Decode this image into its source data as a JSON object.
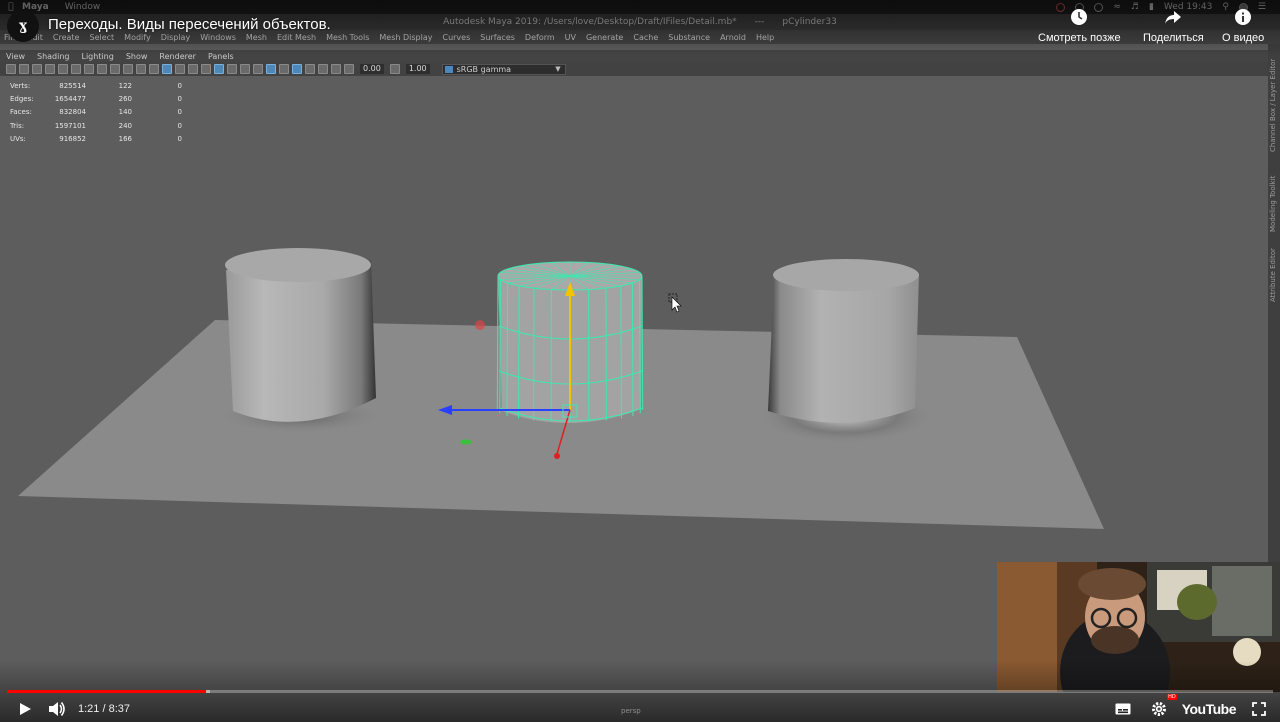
{
  "mac_menubar": {
    "app_name": "Maya",
    "items": [
      "Window"
    ],
    "clock": "Wed 19:43"
  },
  "maya": {
    "window_title": "Autodesk Maya 2019: /Users/love/Desktop/Draft/IFiles/Detail.mb*",
    "sep": "---",
    "selection": "pCylinder33",
    "menus": [
      "File",
      "Edit",
      "Create",
      "Select",
      "Modify",
      "Display",
      "Windows",
      "Mesh",
      "Edit Mesh",
      "Mesh Tools",
      "Mesh Display",
      "Curves",
      "Surfaces",
      "Deform",
      "UV",
      "Generate",
      "Cache",
      "Substance",
      "Arnold",
      "Help"
    ],
    "panel_menus": [
      "View",
      "Shading",
      "Lighting",
      "Show",
      "Renderer",
      "Panels"
    ],
    "toolbar": {
      "exposure": "0.00",
      "gamma": "1.00",
      "color_space": "sRGB gamma"
    },
    "right_tabs": [
      "Channel Box / Layer Editor",
      "Modeling Toolkit",
      "Attribute Editor"
    ],
    "hud": {
      "rows": [
        {
          "label": "Verts:",
          "v1": "825514",
          "v2": "122",
          "v3": "0"
        },
        {
          "label": "Edges:",
          "v1": "1654477",
          "v2": "260",
          "v3": "0"
        },
        {
          "label": "Faces:",
          "v1": "832804",
          "v2": "140",
          "v3": "0"
        },
        {
          "label": "Tris:",
          "v1": "1597101",
          "v2": "240",
          "v3": "0"
        },
        {
          "label": "UVs:",
          "v1": "916852",
          "v2": "166",
          "v3": "0"
        }
      ]
    },
    "camera_label": "persp"
  },
  "youtube": {
    "channel_logo": "ɣ",
    "video_title": "Переходы. Виды пересечений объектов.",
    "actions": {
      "watch_later": "Смотреть позже",
      "share": "Поделиться",
      "about": "О видео"
    },
    "time_current": "1:21",
    "time_sep": "/",
    "time_total": "8:37",
    "played_fraction": 0.157,
    "buffered_fraction": 0.16,
    "brand": "YouTube",
    "hd_badge": "HD",
    "colors": {
      "progress": "#ff0000",
      "maya_select": "#4e88b8",
      "wireframe": "#3ee8b0"
    }
  }
}
